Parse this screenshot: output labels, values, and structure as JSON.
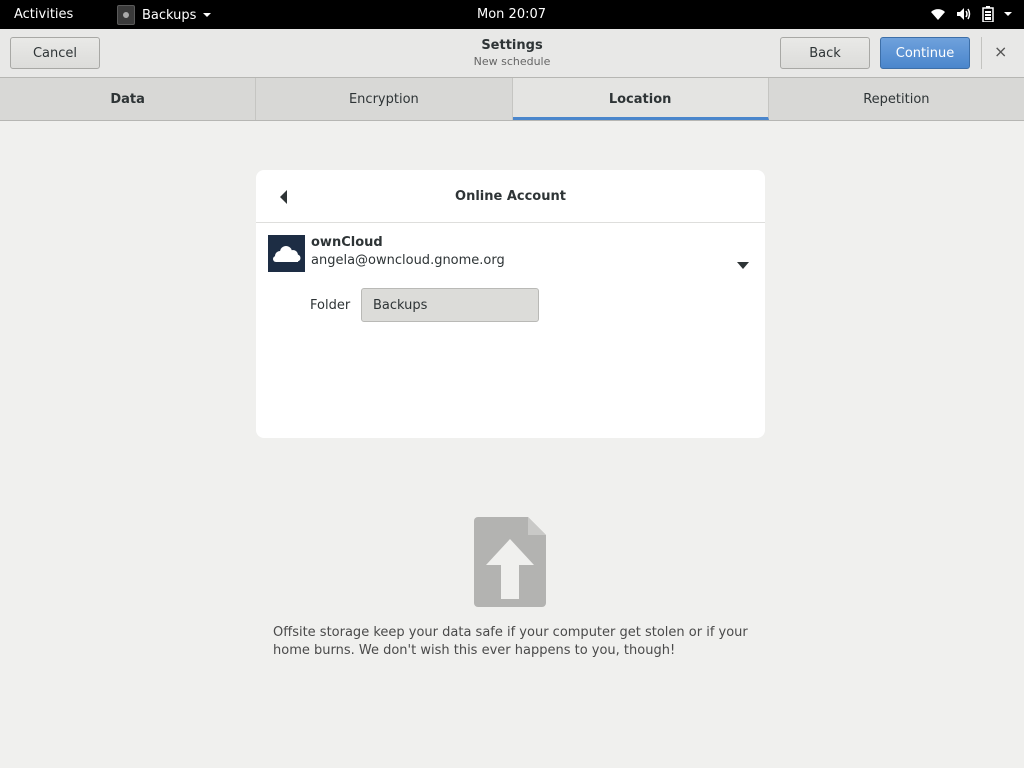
{
  "topbar": {
    "activities": "Activities",
    "app_name": "Backups",
    "clock": "Mon 20:07",
    "icons": [
      "wifi-icon",
      "volume-icon",
      "battery-icon",
      "system-menu-caret-icon"
    ]
  },
  "header": {
    "cancel": "Cancel",
    "title": "Settings",
    "subtitle": "New schedule",
    "back": "Back",
    "continue": "Continue",
    "close": "×"
  },
  "tabs": [
    {
      "label": "Data",
      "active": false
    },
    {
      "label": "Encryption",
      "active": false
    },
    {
      "label": "Location",
      "active": true
    },
    {
      "label": "Repetition",
      "active": false
    }
  ],
  "location": {
    "title": "Online Account",
    "account": {
      "name": "ownCloud",
      "email": "angela@owncloud.gnome.org"
    },
    "folder_label": "Folder",
    "folder_value": "Backups"
  },
  "description": "Offsite storage keep your data safe if your computer get stolen or if your home burns. We don't wish this ever happens to you, though!",
  "colors": {
    "accent": "#4a86cc",
    "logo_bg": "#1d2d44",
    "illustration": "#b3b3b1"
  }
}
